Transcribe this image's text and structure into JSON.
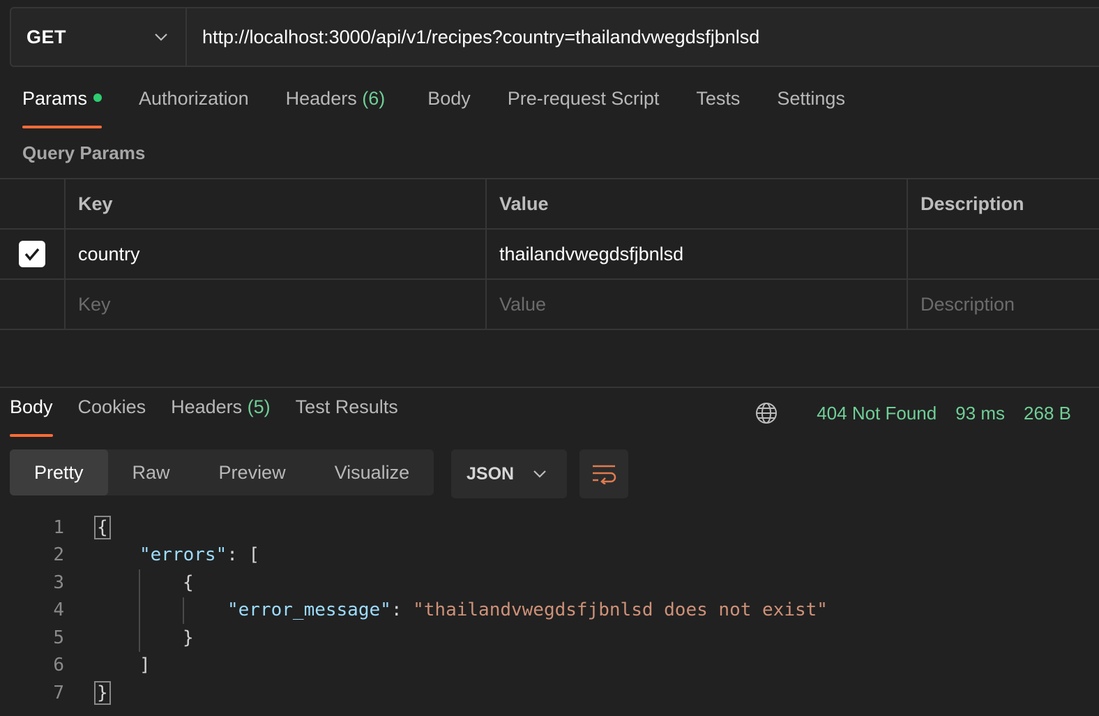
{
  "request": {
    "method": "GET",
    "url": "http://localhost:3000/api/v1/recipes?country=thailandvwegdsfjbnlsd"
  },
  "request_tabs": [
    {
      "label": "Params",
      "count": "",
      "active": true,
      "has_dot": true
    },
    {
      "label": "Authorization",
      "count": ""
    },
    {
      "label": "Headers",
      "count": "(6)"
    },
    {
      "label": "Body",
      "count": ""
    },
    {
      "label": "Pre-request Script",
      "count": ""
    },
    {
      "label": "Tests",
      "count": ""
    },
    {
      "label": "Settings",
      "count": ""
    }
  ],
  "query_params": {
    "title": "Query Params",
    "headers": {
      "key": "Key",
      "value": "Value",
      "description": "Description"
    },
    "rows": [
      {
        "checked": true,
        "key": "country",
        "value": "thailandvwegdsfjbnlsd",
        "description": ""
      }
    ],
    "placeholders": {
      "key": "Key",
      "value": "Value",
      "description": "Description"
    }
  },
  "response_tabs": [
    {
      "label": "Body",
      "count": "",
      "active": true
    },
    {
      "label": "Cookies",
      "count": ""
    },
    {
      "label": "Headers",
      "count": "(5)"
    },
    {
      "label": "Test Results",
      "count": ""
    }
  ],
  "response_status": {
    "icon": "globe-icon",
    "status": "404 Not Found",
    "time": "93 ms",
    "size": "268 B",
    "color": "#6fcf97"
  },
  "view_modes": [
    {
      "label": "Pretty",
      "active": true
    },
    {
      "label": "Raw"
    },
    {
      "label": "Preview"
    },
    {
      "label": "Visualize"
    }
  ],
  "format": {
    "selected": "JSON"
  },
  "code": {
    "line_numbers": [
      "1",
      "2",
      "3",
      "4",
      "5",
      "6",
      "7"
    ],
    "open_brace": "{",
    "errors_key": "\"errors\"",
    "colon": ": ",
    "open_bracket": "[",
    "inner_open": "{",
    "error_message_key": "\"error_message\"",
    "error_message_value": "\"thailandvwegdsfjbnlsd does not exist\"",
    "inner_close": "}",
    "close_bracket": "]",
    "close_brace": "}"
  },
  "colors": {
    "accent": "#ff6c37",
    "success": "#6fcf97",
    "json_key": "#9cdcfe",
    "json_string": "#ce9178"
  }
}
